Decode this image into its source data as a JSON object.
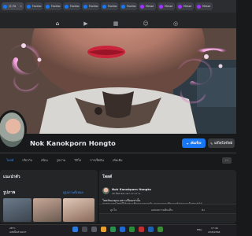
{
  "browser": {
    "tabs": [
      {
        "label": "(5) Fa",
        "active": true
      },
      {
        "label": "Facebo"
      },
      {
        "label": "Facebo"
      },
      {
        "label": "Facebo"
      },
      {
        "label": "Facebo"
      },
      {
        "label": "Facebo"
      },
      {
        "label": "Facebo"
      },
      {
        "label": "Messe"
      },
      {
        "label": "Messe"
      },
      {
        "label": "Messe"
      },
      {
        "label": "Messe"
      }
    ]
  },
  "profile": {
    "name": "Nok Kanokporn Hongto",
    "add_story_label": "เพิ่มเรื่อง",
    "edit_profile_label": "แก้ไขโปรไฟล์"
  },
  "page_tabs": [
    "โพสต์",
    "เกี่ยวกับ",
    "เพื่อน",
    "รูปภาพ",
    "วิดีโอ",
    "การเช็คอิน",
    "เพิ่มเติม"
  ],
  "intro": {
    "title": "แนะนำตัว"
  },
  "photos": {
    "title": "รูปภาพ",
    "see_all": "ดูรูปภาพทั้งหมด"
  },
  "post": {
    "section_title": "โพสต์",
    "author": "Nok Kanokporn Hongto",
    "meta": "29 สิงหาคม เวลา 17:17 น. · ",
    "text_title": "โพสต์ของคุณเฉพาะเพื่อนเท่านั้น",
    "text_body": "คุณสามารถดูโพสต์นี้ได้เฉพาะเพื่อนของคุณเท่านั้น คุณสามารถเปลี่ยนการตั้งค่าความเป็นส่วนตัวได้",
    "actions": [
      "ถูกใจ",
      "แสดงความคิดเห็น",
      "ส่ง"
    ]
  },
  "taskbar": {
    "weather": "28°C",
    "weather_desc": "เมฆเป็นส่วนมาก",
    "lang": "ENG",
    "time": "17:40",
    "date": "29/8/2566"
  }
}
